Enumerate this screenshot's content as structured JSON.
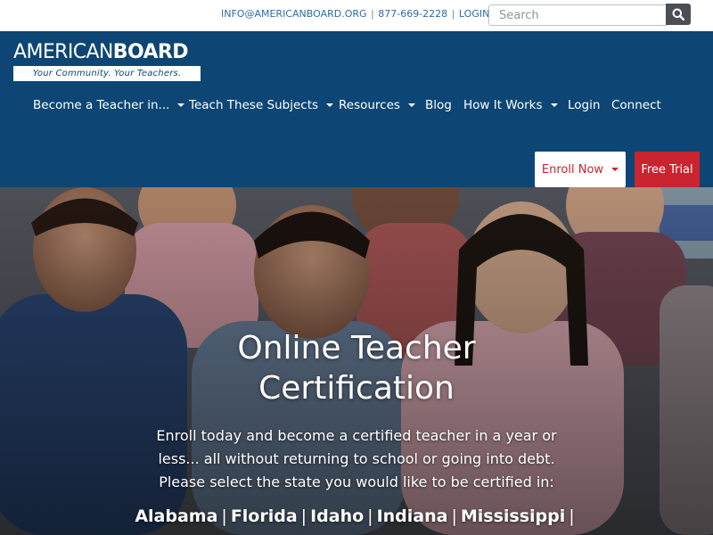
{
  "topbar": {
    "email": "INFO@AMERICANBOARD.ORG",
    "phone": "877-669-2228",
    "login": "LOGIN",
    "separator": "|",
    "search_placeholder": "Search"
  },
  "logo": {
    "name_regular": "AMERICAN",
    "name_bold": "BOARD",
    "tagline": "Your Community. Your Teachers."
  },
  "nav": {
    "items": [
      {
        "label": "Become a Teacher in..."
      },
      {
        "label": "Teach These Subjects"
      },
      {
        "label": "Resources"
      },
      {
        "label": "Blog"
      },
      {
        "label": "How It Works"
      },
      {
        "label": "Login"
      },
      {
        "label": "Connect"
      }
    ],
    "enroll_label": "Enroll Now",
    "trial_label": "Free Trial"
  },
  "hero": {
    "title_line1": "Online Teacher",
    "title_line2": "Certification",
    "description": "Enroll today and become a certified teacher in a year or less... all without returning to school or going into debt. Please select the state you would like to be certified in:",
    "states": [
      "Alabama",
      "Florida",
      "Idaho",
      "Indiana",
      "Mississippi"
    ]
  },
  "colors": {
    "brand_blue": "#0d4674",
    "accent_red": "#c9242f",
    "link_blue": "#2a6ea8"
  },
  "icons": {
    "search_button": "search-icon",
    "dropdown": "caret-down-icon"
  }
}
